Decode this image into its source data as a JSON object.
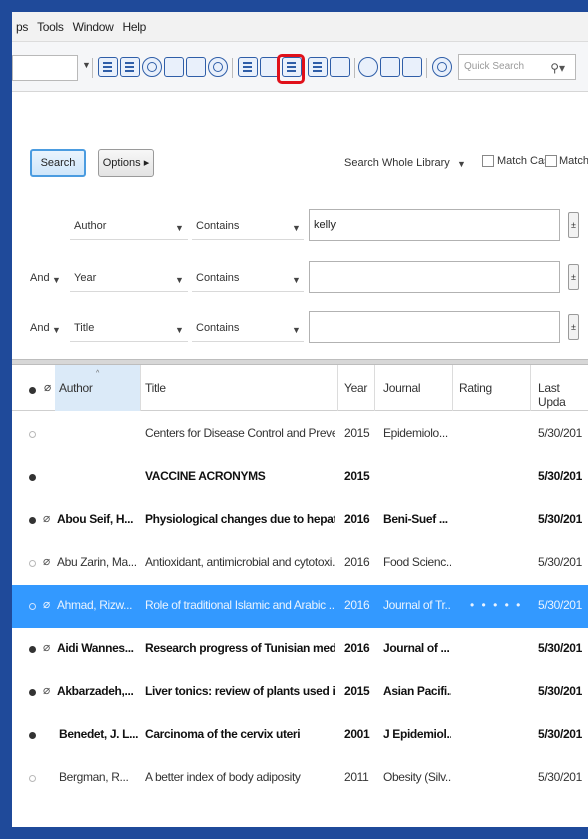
{
  "menubar": {
    "items": [
      "ps",
      "Tools",
      "Window",
      "Help"
    ]
  },
  "toolbar": {
    "quick_search_placeholder": "Quick Search",
    "quick_search_icon": "search-icon",
    "highlighted_button_icon": "format-paper-icon",
    "highlight_color": "#e0101a"
  },
  "search_panel": {
    "search_button": "Search",
    "options_button": "Options",
    "scope": "Search Whole Library",
    "match_case": "Match Case",
    "match_words": "Match Wo",
    "rows": [
      {
        "bool": "",
        "field": "Author",
        "operator": "Contains",
        "value": "kelly"
      },
      {
        "bool": "And",
        "field": "Year",
        "operator": "Contains",
        "value": ""
      },
      {
        "bool": "And",
        "field": "Title",
        "operator": "Contains",
        "value": ""
      }
    ]
  },
  "table": {
    "columns": [
      "Author",
      "Title",
      "Year",
      "Journal",
      "Rating",
      "Last Upda"
    ],
    "rows": [
      {
        "read": false,
        "attachment": false,
        "author": "",
        "title": "Centers for Disease Control and Preven...",
        "year": "2015",
        "journal": "Epidemiolo...",
        "rating": "",
        "last_updated": "5/30/201",
        "bold": false,
        "selected": false
      },
      {
        "read": true,
        "attachment": false,
        "author": "",
        "title": "VACCINE ACRONYMS",
        "year": "2015",
        "journal": "",
        "rating": "",
        "last_updated": "5/30/201",
        "bold": true,
        "selected": false
      },
      {
        "read": true,
        "attachment": true,
        "author": "Abou Seif, H...",
        "title": "Physiological changes due to hepato...",
        "year": "2016",
        "journal": "Beni-Suef ...",
        "rating": "",
        "last_updated": "5/30/201",
        "bold": true,
        "selected": false
      },
      {
        "read": false,
        "attachment": true,
        "author": "Abu Zarin, Ma...",
        "title": "Antioxidant, antimicrobial and cytotoxi...",
        "year": "2016",
        "journal": "Food Scienc...",
        "rating": "",
        "last_updated": "5/30/201",
        "bold": false,
        "selected": false
      },
      {
        "read": false,
        "attachment": true,
        "author": "Ahmad, Rizw...",
        "title": "Role of traditional Islamic and Arabic ...",
        "year": "2016",
        "journal": "Journal of Tr...",
        "rating": "• • • • •",
        "last_updated": "5/30/201",
        "bold": false,
        "selected": true
      },
      {
        "read": true,
        "attachment": true,
        "author": "Aidi Wannes...",
        "title": "Research progress of Tunisian medic...",
        "year": "2016",
        "journal": "Journal of ...",
        "rating": "",
        "last_updated": "5/30/201",
        "bold": true,
        "selected": false
      },
      {
        "read": true,
        "attachment": true,
        "author": "Akbarzadeh,...",
        "title": "Liver tonics: review of plants used in...",
        "year": "2015",
        "journal": "Asian Pacifi...",
        "rating": "",
        "last_updated": "5/30/201",
        "bold": true,
        "selected": false
      },
      {
        "read": true,
        "attachment": false,
        "author": "Benedet, J. L...",
        "title": "Carcinoma of the cervix uteri",
        "year": "2001",
        "journal": "J Epidemiol...",
        "rating": "",
        "last_updated": "5/30/201",
        "bold": true,
        "selected": false
      },
      {
        "read": false,
        "attachment": false,
        "author": "Bergman, R...",
        "title": "A better index of body adiposity",
        "year": "2011",
        "journal": "Obesity (Silv...",
        "rating": "",
        "last_updated": "5/30/201",
        "bold": false,
        "selected": false
      }
    ]
  },
  "colors": {
    "selection": "#3399ff",
    "frame_border": "#1f4a9a"
  }
}
